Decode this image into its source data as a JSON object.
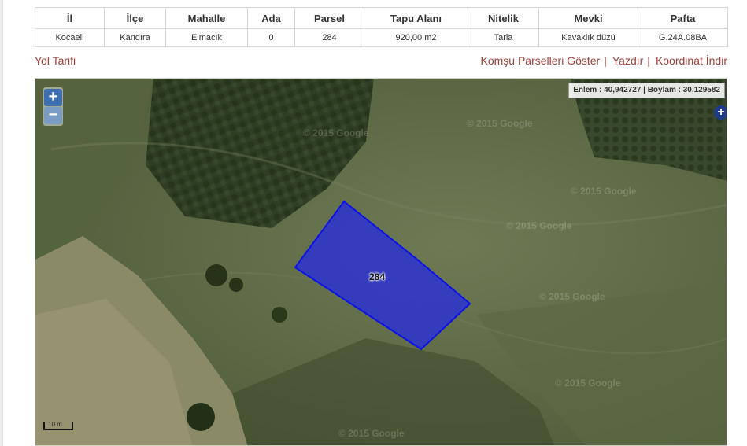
{
  "table": {
    "headers": [
      "İl",
      "İlçe",
      "Mahalle",
      "Ada",
      "Parsel",
      "Tapu Alanı",
      "Nitelik",
      "Mevki",
      "Pafta"
    ],
    "row": [
      "Kocaeli",
      "Kandıra",
      "Elmacık",
      "0",
      "284",
      "920,00 m2",
      "Tarla",
      "Kavaklık düzü",
      "G.24A.08BA"
    ]
  },
  "links": {
    "directions": "Yol Tarifi",
    "neighbors": "Komşu Parselleri Göster",
    "print": "Yazdır",
    "download_coords": "Koordinat İndir"
  },
  "map": {
    "zoom_in": "+",
    "zoom_out": "−",
    "coordinates": "Enlem : 40,942727 | Boylam : 30,129582",
    "layer_switcher": "+",
    "parcel_label": "284",
    "scale": "10 m",
    "watermark": "© 2015 Google",
    "parcel_fill": "#2a2fd6",
    "parcel_stroke": "#0b12e8"
  },
  "colors": {
    "link": "#a0403a",
    "zoom_button": "#3f6fb3"
  }
}
